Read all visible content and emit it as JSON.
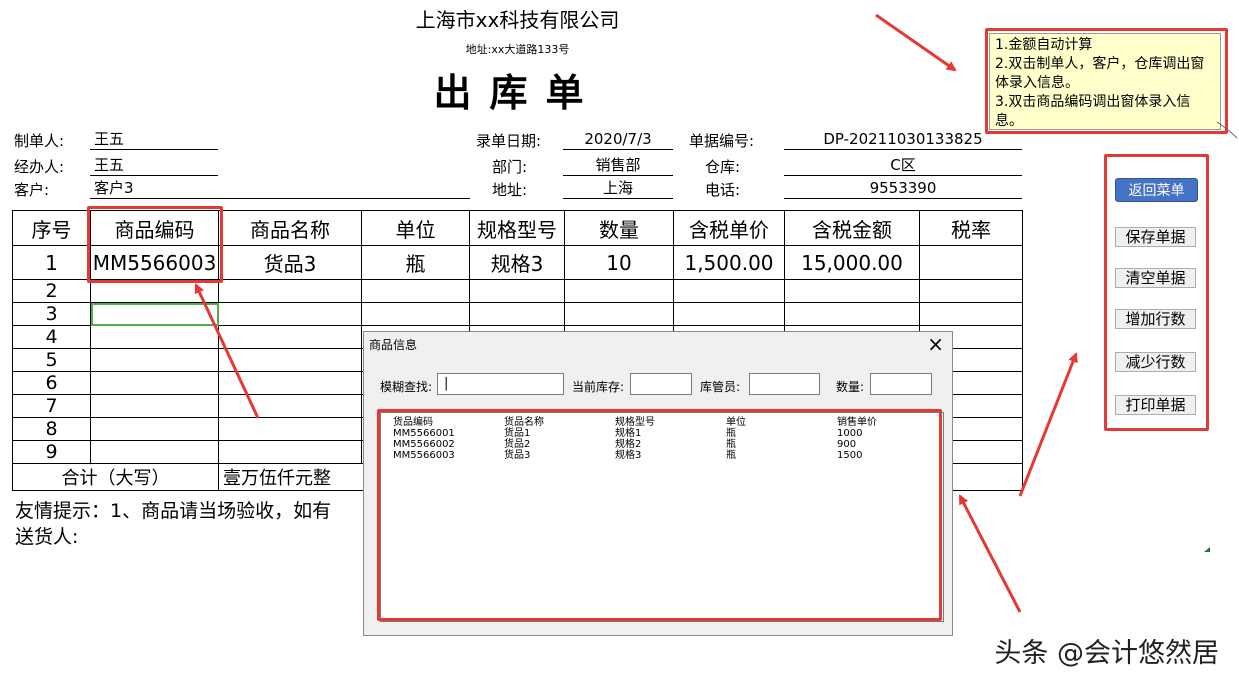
{
  "header": {
    "company": "上海市xx科技有限公司",
    "address": "地址:xx大道路133号",
    "doc_title": "出库单"
  },
  "form": {
    "maker_label": "制单人:",
    "maker": "王五",
    "handler_label": "经办人:",
    "handler": "王五",
    "customer_label": "客户:",
    "customer": "客户3",
    "date_label": "录单日期:",
    "date": "2020/7/3",
    "dept_label": "部门:",
    "dept": "销售部",
    "addr_label": "地址:",
    "addr": "上海",
    "docno_label": "单据编号:",
    "docno": "DP-20211030133825",
    "warehouse_label": "仓库:",
    "warehouse": "C区",
    "phone_label": "电话:",
    "phone": "9553390"
  },
  "table": {
    "headers": [
      "序号",
      "商品编码",
      "商品名称",
      "单位",
      "规格型号",
      "数量",
      "含税单价",
      "含税金额",
      "税率"
    ],
    "row1": [
      "1",
      "MM5566003",
      "货品3",
      "瓶",
      "规格3",
      "10",
      "1,500.00",
      "15,000.00",
      ""
    ],
    "row_numbers": [
      "2",
      "3",
      "4",
      "5",
      "6",
      "7",
      "8",
      "9"
    ],
    "total_label": "合计（大写）",
    "total_value": "壹万伍仟元整"
  },
  "footer": {
    "tip": "友情提示：1、商品请当场验收，如有",
    "sender": "送货人:"
  },
  "note": {
    "lines": [
      "1.金额自动计算",
      "2.双击制单人，客户，仓库调出窗体录入信息。",
      "3.双击商品编码调出窗体录入信息。"
    ]
  },
  "side_buttons": {
    "menu": "返回菜单",
    "save": "保存单据",
    "clear": "清空单据",
    "add_rows": "增加行数",
    "remove_rows": "减少行数",
    "print": "打印单据"
  },
  "dialog": {
    "title": "商品信息",
    "close": "×",
    "search_label": "模糊查找:",
    "search_value": "|",
    "stock_label": "当前库存:",
    "keeper_label": "库管员:",
    "qty_label": "数量:",
    "list_headers": [
      "货品编码",
      "货品名称",
      "规格型号",
      "单位",
      "销售单价"
    ],
    "list_rows": [
      [
        "MM5566001",
        "货品1",
        "规格1",
        "瓶",
        "1000"
      ],
      [
        "MM5566002",
        "货品2",
        "规格2",
        "瓶",
        "900"
      ],
      [
        "MM5566003",
        "货品3",
        "规格3",
        "瓶",
        "1500"
      ]
    ]
  },
  "colors": {
    "annotation_red": "#e53935",
    "menu_blue": "#4472c4",
    "selection_green": "#4caf50",
    "note_bg": "#ffffcc"
  },
  "watermark": "头条 @会计悠然居"
}
